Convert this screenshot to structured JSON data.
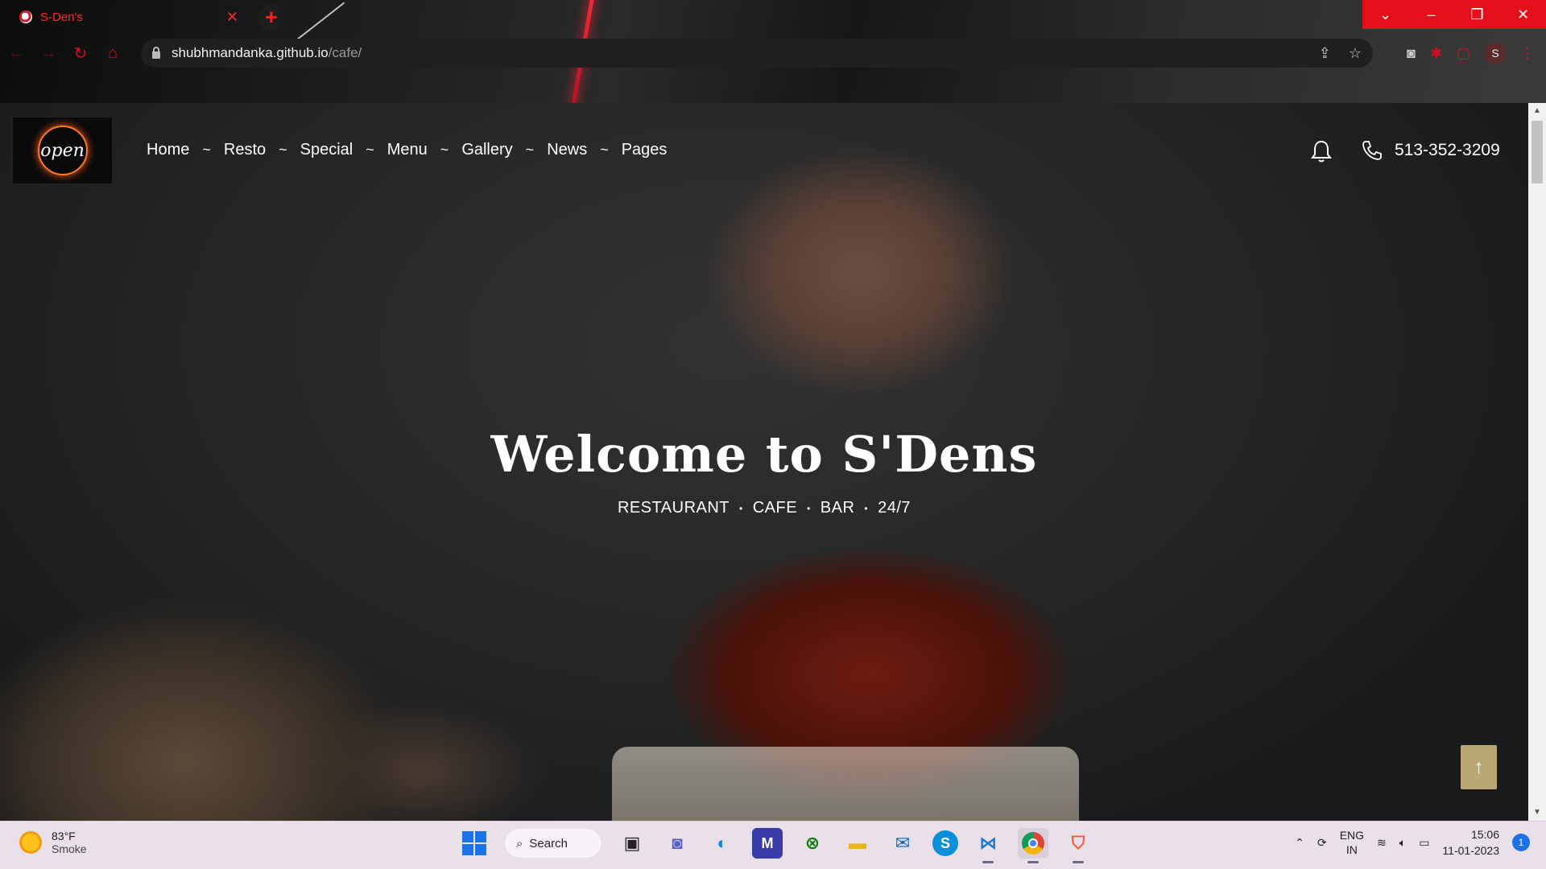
{
  "browser": {
    "tab_title": "S-Den's",
    "url_host": "shubhmandanka.github.io",
    "url_path": "/cafe/",
    "profile_initial": "S",
    "accent_color": "#e3101a"
  },
  "site": {
    "nav": [
      "Home",
      "Resto",
      "Special",
      "Menu",
      "Gallery",
      "News",
      "Pages"
    ],
    "nav_separator": "~",
    "phone": "513-352-3209",
    "logo_text": "open",
    "hero_title": "Welcome to S'Dens",
    "hero_tags": [
      "RESTAURANT",
      "CAFE",
      "BAR",
      "24/7"
    ],
    "back_to_top": "↑",
    "button_color": "#b9a873"
  },
  "taskbar": {
    "weather_temp": "83°F",
    "weather_desc": "Smoke",
    "search_label": "Search",
    "lang_line1": "ENG",
    "lang_line2": "IN",
    "time": "15:06",
    "date": "11-01-2023",
    "notification_count": "1",
    "pinned_apps": [
      "task-view",
      "teams-chat",
      "edge",
      "visual-studio",
      "xbox",
      "file-explorer",
      "mail",
      "skype",
      "vscode",
      "chrome",
      "brave"
    ]
  }
}
